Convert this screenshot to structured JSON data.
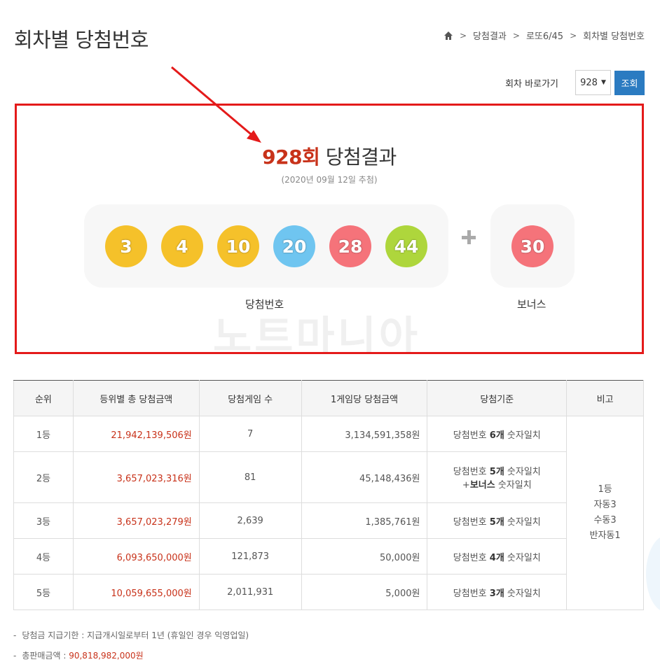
{
  "page": {
    "title": "회차별 당첨번호"
  },
  "breadcrumb": {
    "items": [
      "당첨결과",
      "로또6/45",
      "회차별 당첨번호"
    ]
  },
  "round_nav": {
    "label": "회차 바로가기",
    "selected": "928",
    "button": "조회"
  },
  "result": {
    "round": "928회",
    "title_suffix": "당첨결과",
    "date": "(2020년 09월 12일 추첨)",
    "numbers": [
      {
        "value": "3",
        "color": "#f5c12a"
      },
      {
        "value": "4",
        "color": "#f5c12a"
      },
      {
        "value": "10",
        "color": "#f5c12a"
      },
      {
        "value": "20",
        "color": "#6fc5f0"
      },
      {
        "value": "28",
        "color": "#f5737a"
      },
      {
        "value": "44",
        "color": "#aed63c"
      }
    ],
    "bonus": {
      "value": "30",
      "color": "#f5737a"
    },
    "numbers_label": "당첨번호",
    "bonus_label": "보너스",
    "watermark": "노트마니아"
  },
  "table": {
    "headers": [
      "순위",
      "등위별 총 당첨금액",
      "당첨게임 수",
      "1게임당 당첨금액",
      "당첨기준",
      "비고"
    ],
    "rows": [
      {
        "rank": "1등",
        "total": "21,942,139,506원",
        "winners": "7",
        "per_game": "3,134,591,358원",
        "crit_pre": "당첨번호 ",
        "crit_bold": "6개",
        "crit_post": " 숫자일치"
      },
      {
        "rank": "2등",
        "total": "3,657,023,316원",
        "winners": "81",
        "per_game": "45,148,436원",
        "crit_pre": "당첨번호 ",
        "crit_bold": "5개",
        "crit_post": " 숫자일치",
        "crit2_pre": "+",
        "crit2_bold": "보너스",
        "crit2_post": " 숫자일치"
      },
      {
        "rank": "3등",
        "total": "3,657,023,279원",
        "winners": "2,639",
        "per_game": "1,385,761원",
        "crit_pre": "당첨번호 ",
        "crit_bold": "5개",
        "crit_post": " 숫자일치"
      },
      {
        "rank": "4등",
        "total": "6,093,650,000원",
        "winners": "121,873",
        "per_game": "50,000원",
        "crit_pre": "당첨번호 ",
        "crit_bold": "4개",
        "crit_post": " 숫자일치"
      },
      {
        "rank": "5등",
        "total": "10,059,655,000원",
        "winners": "2,011,931",
        "per_game": "5,000원",
        "crit_pre": "당첨번호 ",
        "crit_bold": "3개",
        "crit_post": " 숫자일치"
      }
    ],
    "note": [
      "1등",
      "자동3",
      "수동3",
      "반자동1"
    ]
  },
  "footnotes": {
    "dash": "-",
    "payout_label": "당첨금 지급기한 : 지급개시일로부터 1년 (휴일인 경우 익영업일)",
    "sales_label": "총판매금액 : ",
    "sales_value": "90,818,982,000원"
  },
  "icons": {
    "home": "home-icon",
    "separator": "chevron-right-icon",
    "caret": "caret-down-icon",
    "plus": "plus-icon",
    "annotation": "red-arrow-icon"
  },
  "colors": {
    "accent_red": "#c8321a",
    "button_blue": "#2b7bc1",
    "highlight_border": "#e41a1a"
  }
}
